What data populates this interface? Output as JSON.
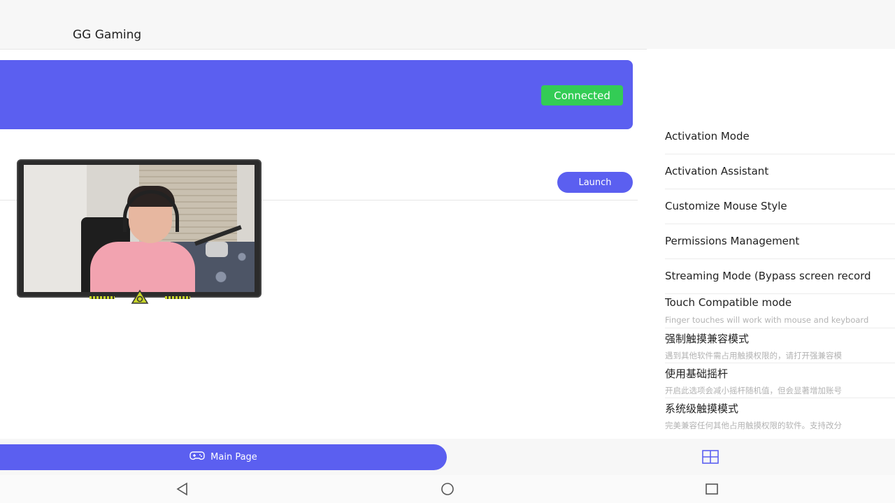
{
  "header": {
    "title": "GG Gaming"
  },
  "banner": {
    "status": "Connected",
    "status_color": "#33cc55",
    "accent": "#5b5ff0"
  },
  "game": {
    "launch_label": "Launch"
  },
  "settings_menu": {
    "items": [
      {
        "label": "Activation Mode"
      },
      {
        "label": "Activation Assistant"
      },
      {
        "label": "Customize Mouse Style"
      },
      {
        "label": "Permissions Management"
      },
      {
        "label": "Streaming Mode (Bypass screen record"
      },
      {
        "label": "Touch Compatible mode",
        "description": "Finger touches will work with mouse and keyboard"
      },
      {
        "label": "强制触摸兼容模式",
        "description": "遇到其他软件需占用触摸权限的，请打开强兼容模"
      },
      {
        "label": "使用基础摇杆",
        "description": "开启此选项会减小摇杆随机值，但会显著增加账号"
      },
      {
        "label": "系统级触摸模式",
        "description": "完美兼容任何其他占用触摸权限的软件。支持改分"
      }
    ]
  },
  "bottom_nav": {
    "main_label": "Main Page",
    "main_icon": "gamepad-icon",
    "secondary_icon": "grid-icon"
  },
  "system_nav": {
    "icons": [
      "back-icon",
      "home-icon",
      "recents-icon"
    ]
  }
}
